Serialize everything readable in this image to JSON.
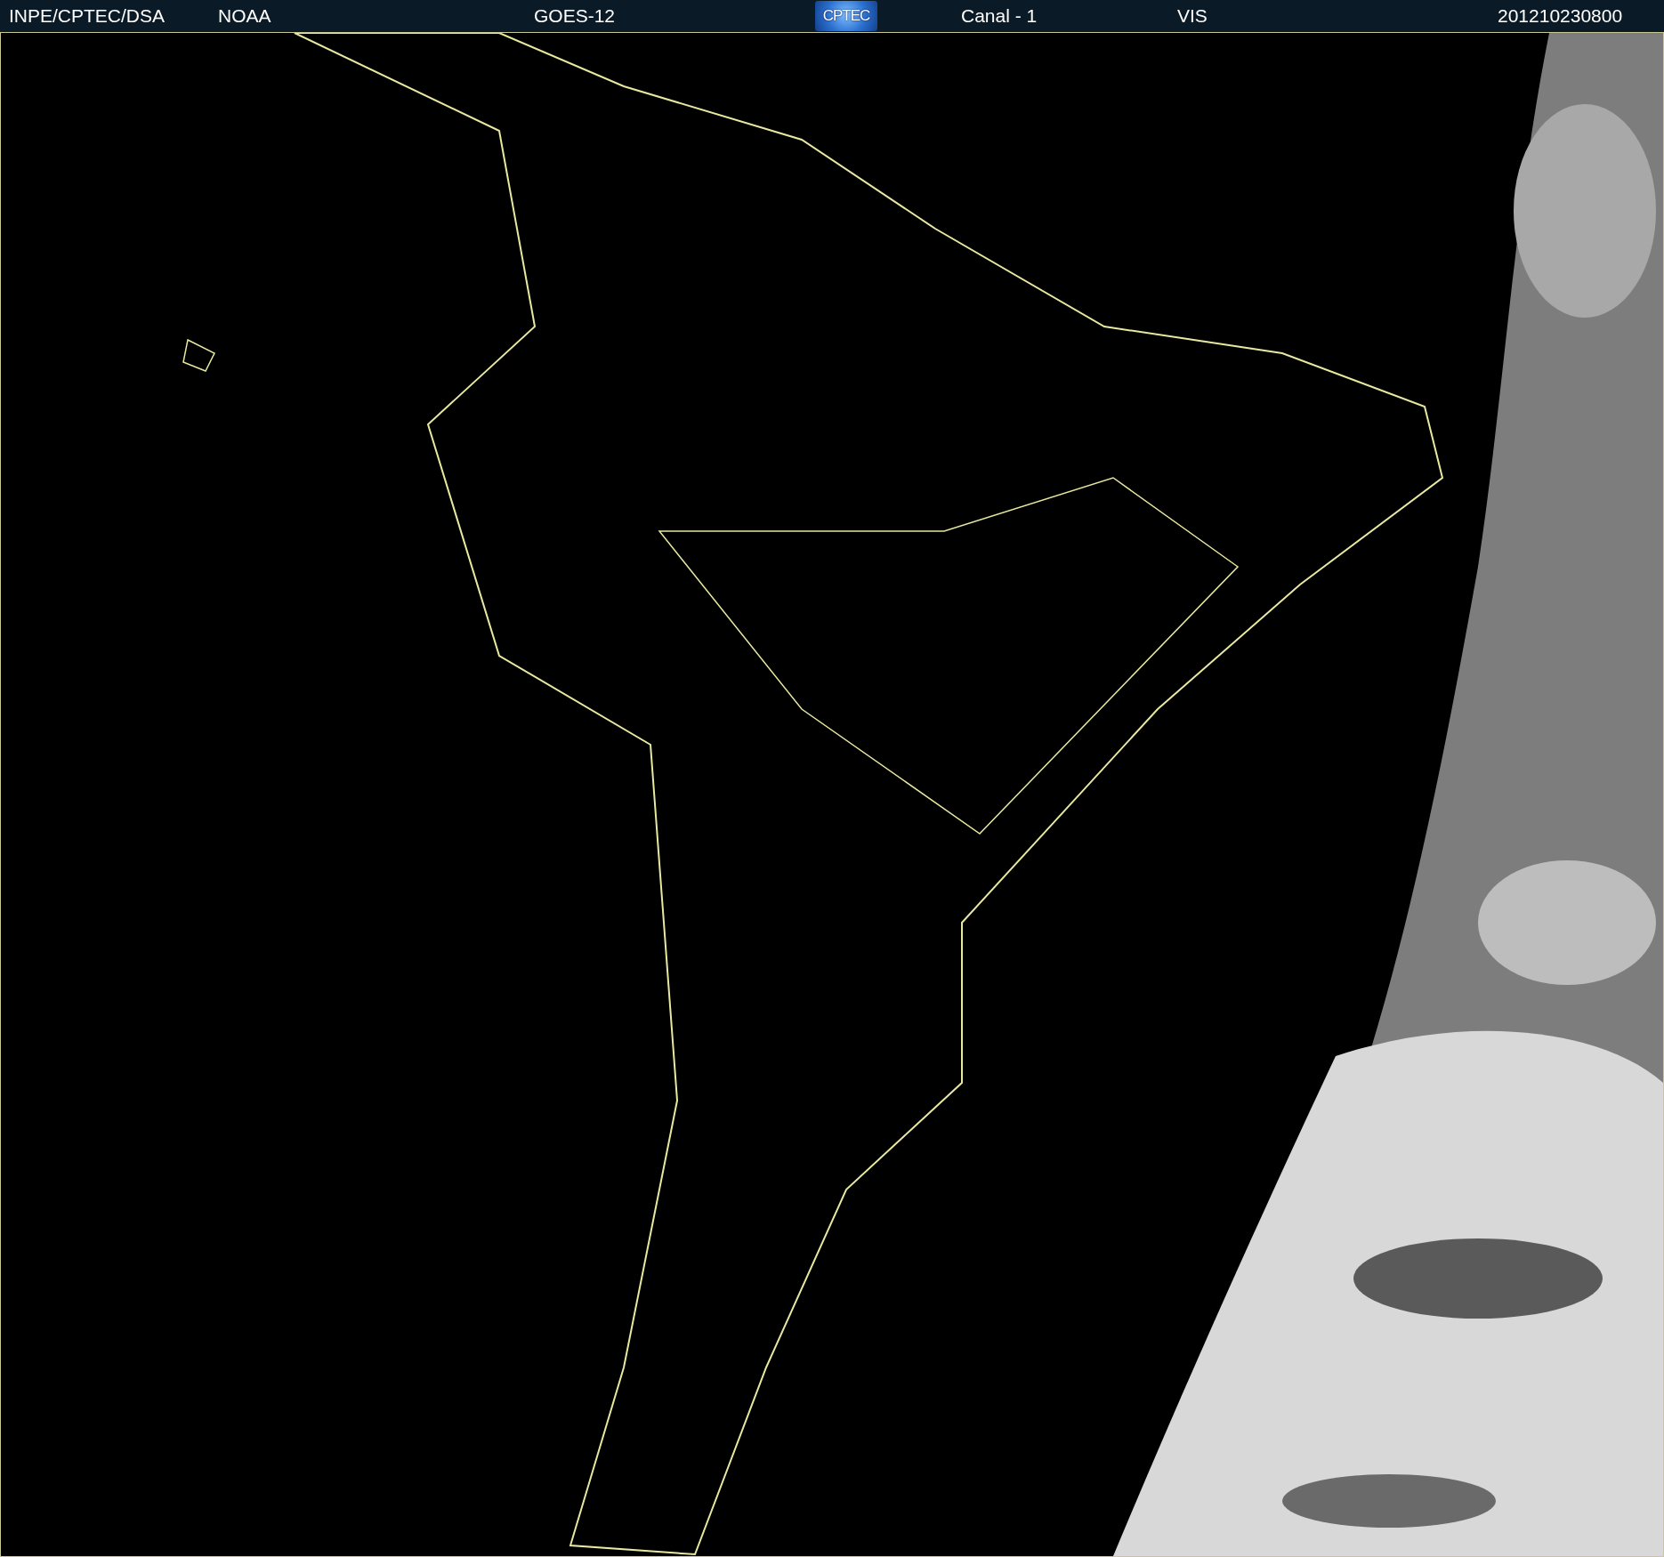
{
  "header": {
    "source": "INPE/CPTEC/DSA",
    "agency": "NOAA",
    "satellite": "GOES-12",
    "logo": "CPTEC",
    "channel": "Canal - 1",
    "band": "VIS",
    "timestamp": "201210230800"
  }
}
